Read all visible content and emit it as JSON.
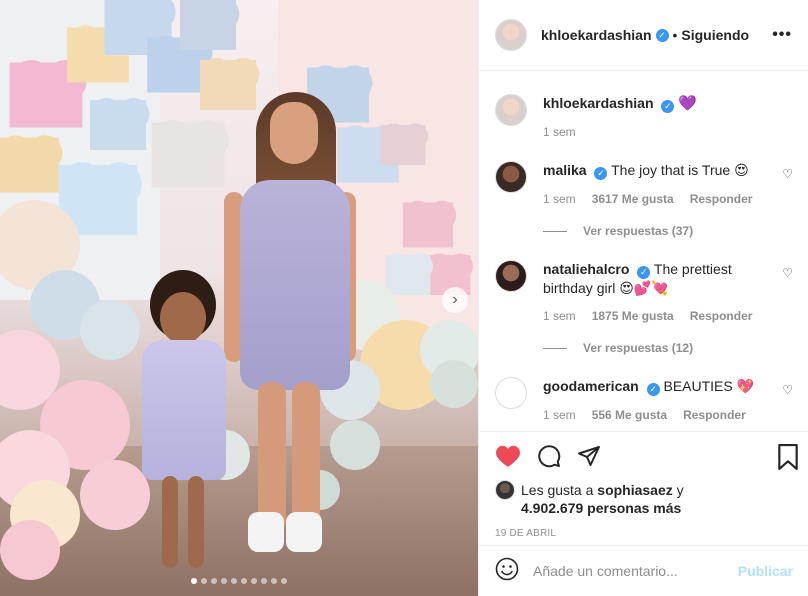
{
  "header": {
    "username": "khloekardashian",
    "verified_mark": "✓",
    "separator": "•",
    "follow_status": "Siguiendo",
    "more_label": "•••"
  },
  "caption": {
    "username": "khloekardashian",
    "emoji": "💜",
    "time": "1 sem"
  },
  "comments": [
    {
      "username": "malika",
      "text": "The joy that is True 😍",
      "time": "1 sem",
      "likes": "3617 Me gusta",
      "reply_label": "Responder",
      "view_replies": "Ver respuestas (37)"
    },
    {
      "username": "nataliehalcro",
      "text": "The prettiest birthday girl 😍💕💘",
      "time": "1 sem",
      "likes": "1875 Me gusta",
      "reply_label": "Responder",
      "view_replies": "Ver respuestas (12)"
    },
    {
      "username": "goodamerican",
      "text": "BEAUTIES 💖",
      "time": "1 sem",
      "likes": "556 Me gusta",
      "reply_label": "Responder"
    }
  ],
  "actions": {
    "liked_by_prefix": "Les gusta a",
    "liked_by_user": "sophiasaez",
    "liked_by_suffix": "y",
    "others": "4.902.679 personas más",
    "date": "19 DE ABRIL"
  },
  "add_comment": {
    "placeholder": "Añade un comentario...",
    "post_label": "Publicar"
  },
  "media": {
    "next_arrow": "›",
    "carousel_count": 10,
    "carousel_active": 0
  },
  "colors": {
    "verified": "#3897f0",
    "like_red": "#ed4956",
    "post_disabled": "#b2dffc",
    "caption_emoji": "#8e44ad"
  },
  "icons": {
    "header_more": "more-icon",
    "like": "heart-icon",
    "comment": "comment-icon",
    "share": "share-icon",
    "save": "bookmark-icon",
    "emoji": "emoji-icon"
  }
}
